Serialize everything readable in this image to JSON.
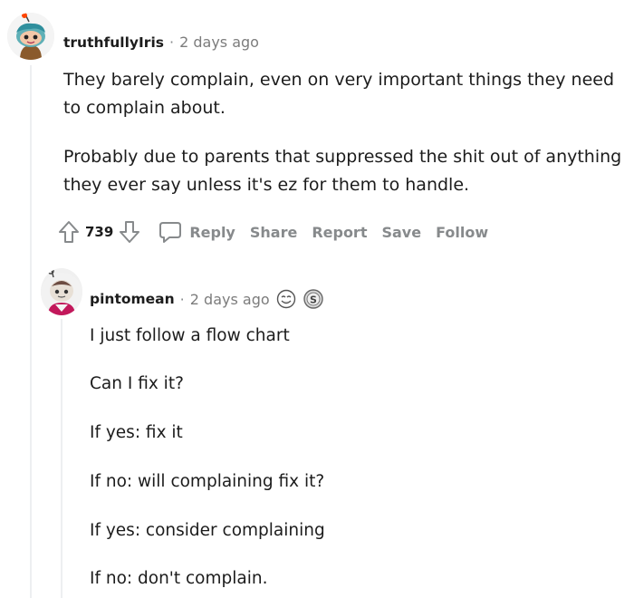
{
  "comment1": {
    "author": "truthfullyIris",
    "separator": "·",
    "time": "2 days ago",
    "paragraphs": [
      "They barely complain, even on very important things they need to complain about.",
      "Probably due to parents that suppressed the shit out of anything they ever say unless it's ez for them to handle."
    ],
    "vote_count": "739",
    "actions": {
      "reply": "Reply",
      "share": "Share",
      "report": "Report",
      "save": "Save",
      "follow": "Follow"
    }
  },
  "comment2": {
    "author": "pintomean",
    "separator": "·",
    "time": "2 days ago",
    "paragraphs": [
      "I just follow a flow chart",
      "Can I fix it?",
      "If yes: fix it",
      "If no: will complaining fix it?",
      "If yes: consider complaining",
      "If no: don't complain."
    ]
  },
  "icons": {
    "upvote": "upvote-arrow-icon",
    "downvote": "downvote-arrow-icon",
    "reply": "speech-bubble-icon",
    "award1": "face-award-icon",
    "award2": "silver-coin-award-icon"
  },
  "colors": {
    "meta_gray": "#878a8c",
    "text": "#1c1c1c",
    "thread_line": "#edeff1"
  }
}
